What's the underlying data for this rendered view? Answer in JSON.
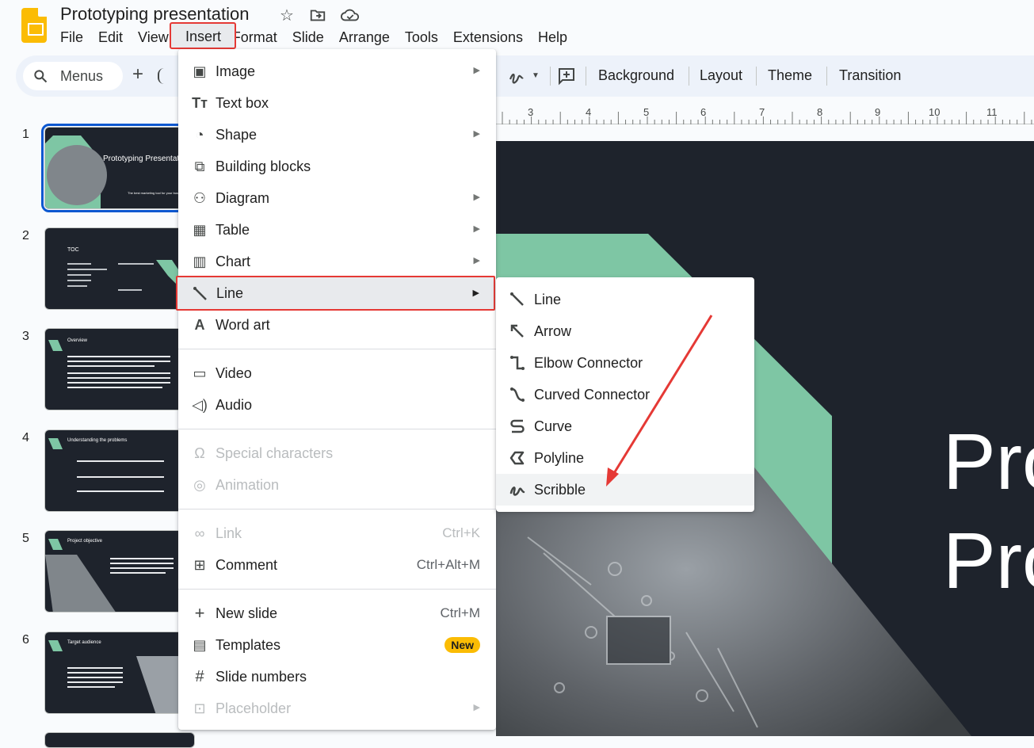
{
  "header": {
    "title": "Prototyping presentation",
    "icons": [
      "star-icon",
      "move-to-folder-icon",
      "cloud-saved-icon"
    ],
    "menus": [
      "File",
      "Edit",
      "View",
      "Insert",
      "Format",
      "Slide",
      "Arrange",
      "Tools",
      "Extensions",
      "Help"
    ]
  },
  "toolbar": {
    "search_label": "Menus",
    "buttons": [
      "Background",
      "Layout",
      "Theme",
      "Transition"
    ]
  },
  "ruler": {
    "numbers": [
      "3",
      "4",
      "5",
      "6",
      "7",
      "8",
      "9",
      "10",
      "11"
    ]
  },
  "slides": [
    {
      "num": "1",
      "title": "Prototyping Presentation",
      "caption": "The best marketing tool for your business"
    },
    {
      "num": "2",
      "title": "TOC"
    },
    {
      "num": "3",
      "title": "Overview"
    },
    {
      "num": "4",
      "title": "Understanding the problems"
    },
    {
      "num": "5",
      "title": "Project objective"
    },
    {
      "num": "6",
      "title": "Target audience"
    }
  ],
  "canvas": {
    "title_fragment_1": "Pro",
    "title_fragment_2": "Pro"
  },
  "insert_menu": {
    "items": [
      {
        "label": "Image",
        "icon": "image-icon",
        "submenu": true
      },
      {
        "label": "Text box",
        "icon": "text-box-icon"
      },
      {
        "label": "Shape",
        "icon": "shape-icon",
        "submenu": true
      },
      {
        "label": "Building blocks",
        "icon": "building-blocks-icon"
      },
      {
        "label": "Diagram",
        "icon": "diagram-icon",
        "submenu": true
      },
      {
        "label": "Table",
        "icon": "table-icon",
        "submenu": true
      },
      {
        "label": "Chart",
        "icon": "chart-icon",
        "submenu": true
      },
      {
        "label": "Line",
        "icon": "line-icon",
        "submenu": true
      },
      {
        "label": "Word art",
        "icon": "word-art-icon"
      },
      {
        "label": "Video",
        "icon": "video-icon"
      },
      {
        "label": "Audio",
        "icon": "audio-icon"
      },
      {
        "label": "Special characters",
        "icon": "omega-icon",
        "disabled": true
      },
      {
        "label": "Animation",
        "icon": "animation-icon",
        "disabled": true
      },
      {
        "label": "Link",
        "icon": "link-icon",
        "shortcut": "Ctrl+K",
        "disabled": true
      },
      {
        "label": "Comment",
        "icon": "comment-icon",
        "shortcut": "Ctrl+Alt+M"
      },
      {
        "label": "New slide",
        "icon": "plus-icon",
        "shortcut": "Ctrl+M"
      },
      {
        "label": "Templates",
        "icon": "templates-icon",
        "badge": "New"
      },
      {
        "label": "Slide numbers",
        "icon": "hash-icon"
      },
      {
        "label": "Placeholder",
        "icon": "placeholder-icon",
        "submenu": true,
        "disabled": true
      }
    ]
  },
  "line_submenu": {
    "items": [
      {
        "label": "Line",
        "icon": "line-icon"
      },
      {
        "label": "Arrow",
        "icon": "arrow-icon"
      },
      {
        "label": "Elbow Connector",
        "icon": "elbow-connector-icon"
      },
      {
        "label": "Curved Connector",
        "icon": "curved-connector-icon"
      },
      {
        "label": "Curve",
        "icon": "curve-icon"
      },
      {
        "label": "Polyline",
        "icon": "polyline-icon"
      },
      {
        "label": "Scribble",
        "icon": "scribble-icon"
      }
    ]
  },
  "colors": {
    "accent_red": "#e53935",
    "selection_blue": "#0b57d0",
    "slide_dark": "#1e232c",
    "slide_green": "#7ec6a4",
    "badge_yellow": "#fbbc04"
  }
}
